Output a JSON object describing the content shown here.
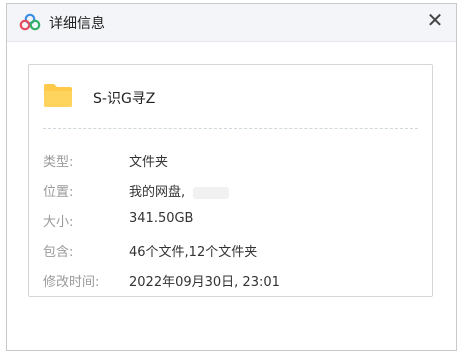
{
  "window": {
    "title": "详细信息",
    "close_glyph": "✕"
  },
  "file": {
    "name": "S-识G寻Z",
    "icon": "folder-icon",
    "icon_color": "#ffc94a"
  },
  "details": [
    {
      "label": "类型:",
      "value": "文件夹"
    },
    {
      "label": "位置:",
      "value": "我的网盘,"
    },
    {
      "label": "大小:",
      "value": "341.50GB"
    },
    {
      "label": "包含:",
      "value": "46个文件,12个文件夹"
    },
    {
      "label": "修改时间:",
      "value": "2022年09月30日, 23:01"
    }
  ],
  "colors": {
    "titlebar_bg": "#f3f5f8",
    "label": "#9a9a9a",
    "value": "#333333"
  }
}
